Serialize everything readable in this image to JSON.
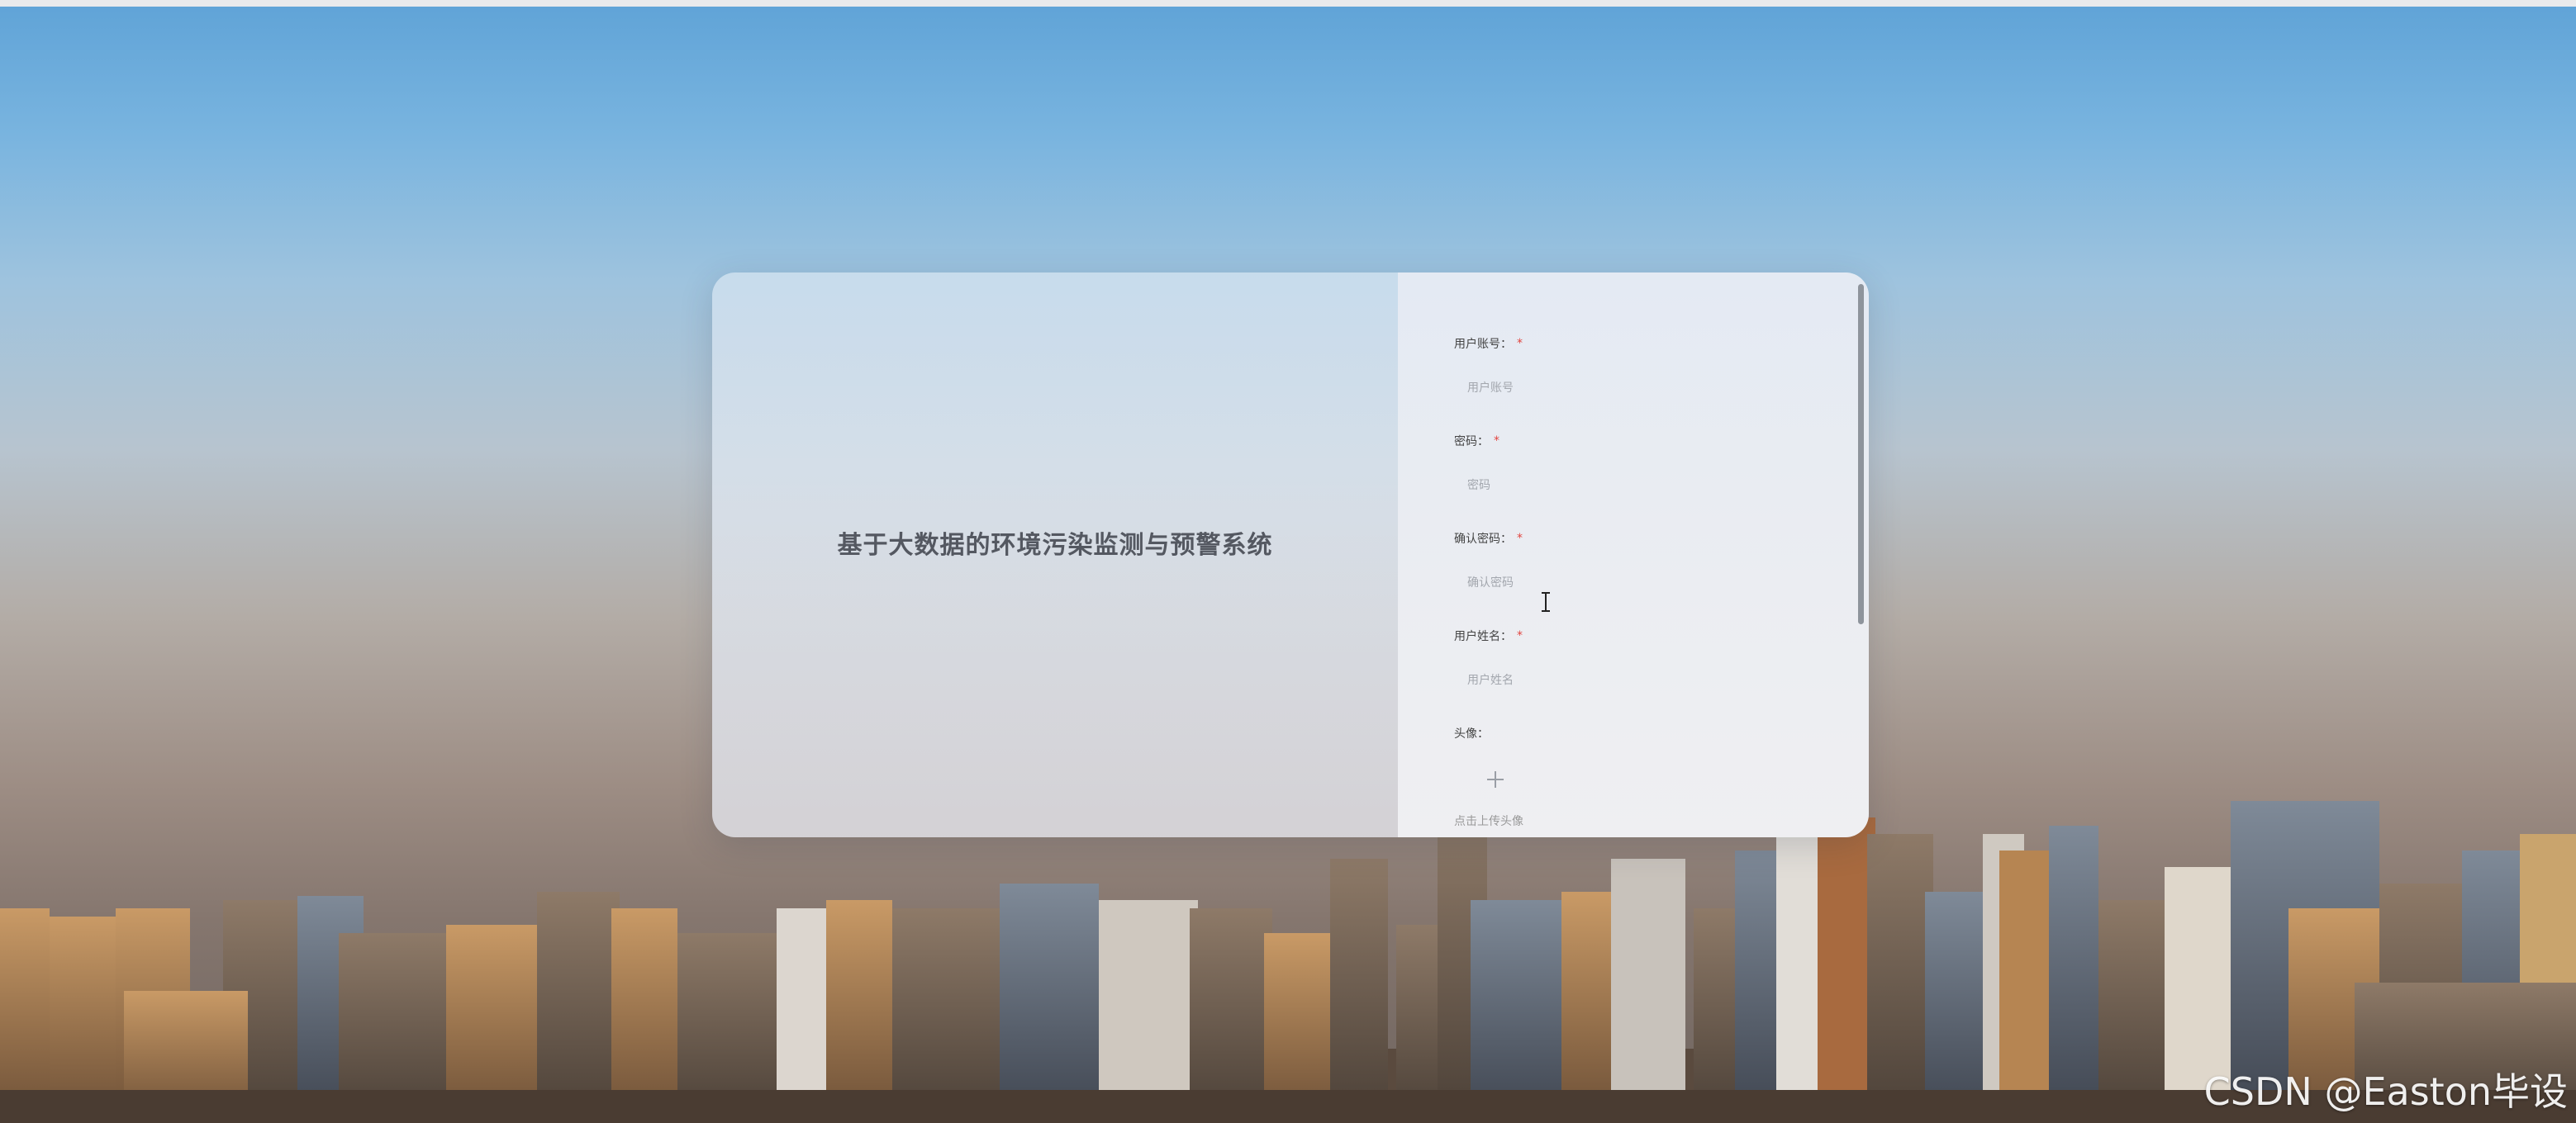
{
  "system_title": "基于大数据的环境污染监测与预警系统",
  "form": {
    "account": {
      "label": "用户账号：",
      "placeholder": "用户账号"
    },
    "password": {
      "label": "密码：",
      "placeholder": "密码"
    },
    "confirm_password": {
      "label": "确认密码：",
      "placeholder": "确认密码"
    },
    "name": {
      "label": "用户姓名：",
      "placeholder": "用户姓名"
    },
    "avatar": {
      "label": "头像：",
      "caption": "点击上传头像"
    },
    "required_mark": "*"
  },
  "watermark": "CSDN @Easton毕设",
  "colors": {
    "required": "#e2453f",
    "title": "#545861"
  },
  "icons": {
    "avatar_upload": "plus-icon",
    "cursor": "text-cursor-icon"
  }
}
